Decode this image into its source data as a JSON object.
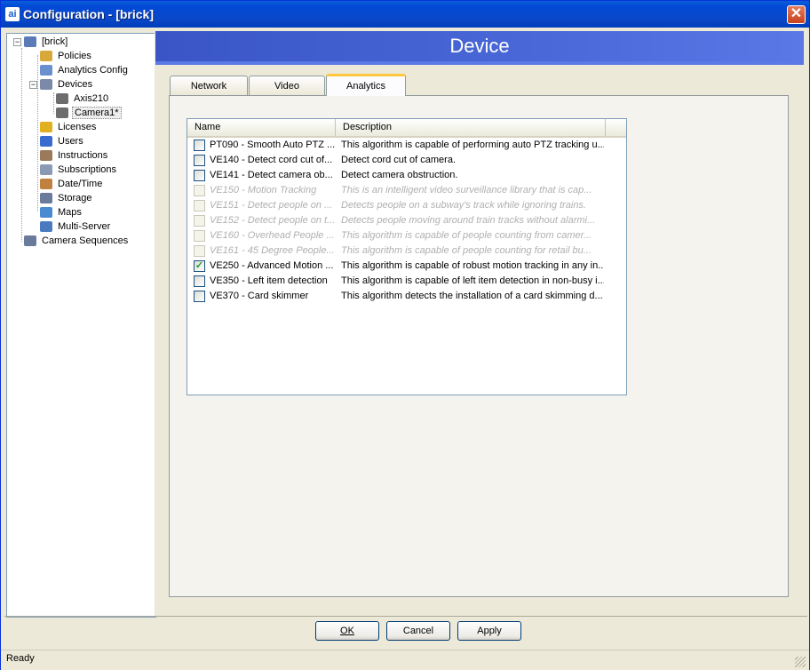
{
  "window": {
    "title": "Configuration - [brick]",
    "app_icon": "ai"
  },
  "tree": {
    "root": "[brick]",
    "items": [
      {
        "label": "Policies",
        "icon": "policies-icon",
        "color": "#d9a83a"
      },
      {
        "label": "Analytics Config",
        "icon": "analytics-config-icon",
        "color": "#6a8fcf"
      },
      {
        "label": "Devices",
        "icon": "devices-icon",
        "color": "#7a8aa8"
      },
      {
        "label": "Axis210",
        "icon": "camera-icon",
        "color": "#6d6d6d"
      },
      {
        "label": "Camera1*",
        "icon": "camera-icon",
        "color": "#6d6d6d"
      },
      {
        "label": "Licenses",
        "icon": "licenses-icon",
        "color": "#e0b020"
      },
      {
        "label": "Users",
        "icon": "users-icon",
        "color": "#3a6ccf"
      },
      {
        "label": "Instructions",
        "icon": "instructions-icon",
        "color": "#9a7a5a"
      },
      {
        "label": "Subscriptions",
        "icon": "subscriptions-icon",
        "color": "#8a9ab5"
      },
      {
        "label": "Date/Time",
        "icon": "clock-icon",
        "color": "#c08040"
      },
      {
        "label": "Storage",
        "icon": "storage-icon",
        "color": "#6a7a9a"
      },
      {
        "label": "Maps",
        "icon": "maps-icon",
        "color": "#4a8ad0"
      },
      {
        "label": "Multi-Server",
        "icon": "multi-server-icon",
        "color": "#4a7ac0"
      },
      {
        "label": "Camera Sequences",
        "icon": "camera-sequences-icon",
        "color": "#6a7a9a"
      }
    ]
  },
  "header": {
    "title": "Device"
  },
  "tabs": [
    {
      "label": "Network",
      "active": false
    },
    {
      "label": "Video",
      "active": false
    },
    {
      "label": "Analytics",
      "active": true
    }
  ],
  "table": {
    "columns": [
      "Name",
      "Description"
    ],
    "rows": [
      {
        "name": "PT090 - Smooth Auto PTZ ...",
        "desc": "This algorithm is capable of performing auto PTZ tracking u...",
        "checked": false,
        "enabled": true
      },
      {
        "name": "VE140 - Detect cord cut of...",
        "desc": "Detect cord cut of camera.",
        "checked": false,
        "enabled": true
      },
      {
        "name": "VE141 - Detect camera ob...",
        "desc": "Detect camera obstruction.",
        "checked": false,
        "enabled": true
      },
      {
        "name": "VE150 - Motion Tracking",
        "desc": "This is an intelligent video surveillance library that is cap...",
        "checked": false,
        "enabled": false
      },
      {
        "name": "VE151 - Detect people on ...",
        "desc": "Detects people on a subway's track while ignoring trains.",
        "checked": false,
        "enabled": false
      },
      {
        "name": "VE152 - Detect people on t...",
        "desc": "Detects people moving around train tracks without alarmi...",
        "checked": false,
        "enabled": false
      },
      {
        "name": "VE160 - Overhead People ...",
        "desc": "This algorithm is capable of people counting from camer...",
        "checked": false,
        "enabled": false
      },
      {
        "name": "VE161 - 45 Degree People...",
        "desc": "This algorithm is capable of people counting for retail bu...",
        "checked": false,
        "enabled": false
      },
      {
        "name": "VE250 - Advanced Motion ...",
        "desc": "This algorithm is capable of robust motion tracking in any in...",
        "checked": true,
        "enabled": true
      },
      {
        "name": "VE350 - Left item detection",
        "desc": "This algorithm is capable of left item detection in non-busy i...",
        "checked": false,
        "enabled": true
      },
      {
        "name": "VE370 - Card skimmer",
        "desc": "This algorithm detects the installation of a card skimming d...",
        "checked": false,
        "enabled": true
      }
    ]
  },
  "buttons": {
    "ok": "OK",
    "cancel": "Cancel",
    "apply": "Apply"
  },
  "status": {
    "text": "Ready"
  }
}
